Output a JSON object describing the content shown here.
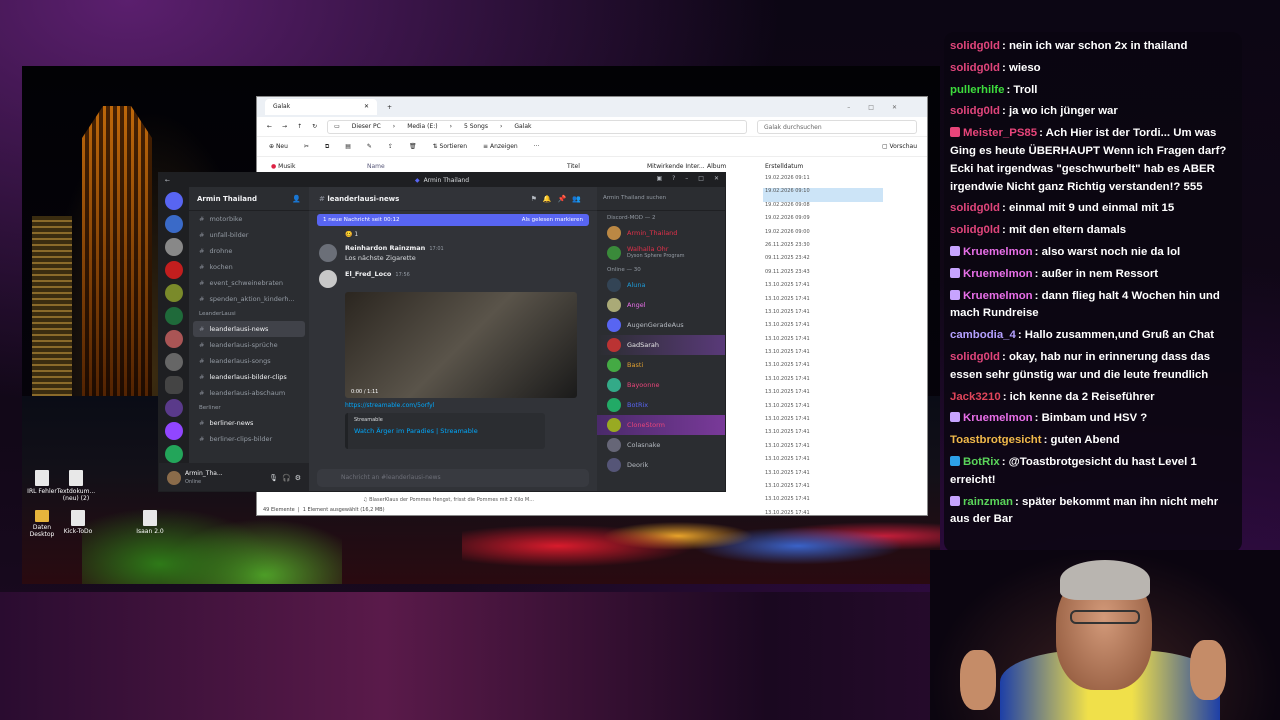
{
  "explorer": {
    "tab_title": "Galak",
    "crumbs": [
      "Dieser PC",
      "Media (E:)",
      "5 Songs",
      "Galak"
    ],
    "search_placeholder": "Galak durchsuchen",
    "cmd_new": "Neu",
    "cmd_sort": "Sortieren",
    "cmd_view": "Anzeigen",
    "cmd_preview": "Vorschau",
    "nav_item": "Musik",
    "col_name": "Name",
    "col_title": "Titel",
    "col_artist": "Mitwirkende Inter...",
    "col_album": "Album",
    "col_created": "Erstelldatum",
    "dates": [
      "19.02.2026 09:11",
      "19.02.2026 09:10",
      "19.02.2026 09:08",
      "19.02.2026 09:09",
      "19.02.2026 09:00",
      "26.11.2025 23:30",
      "09.11.2025 23:42",
      "09.11.2025 23:43",
      "13.10.2025 17:41",
      "13.10.2025 17:41",
      "13.10.2025 17:41",
      "13.10.2025 17:41",
      "13.10.2025 17:41",
      "13.10.2025 17:41",
      "13.10.2025 17:41",
      "13.10.2025 17:41",
      "13.10.2025 17:41",
      "13.10.2025 17:41",
      "13.10.2025 17:41",
      "13.10.2025 17:41",
      "13.10.2025 17:41",
      "13.10.2025 17:41",
      "13.10.2025 17:41",
      "13.10.2025 17:41",
      "13.10.2025 17:41",
      "13.10.2025 17:41",
      "13.10.2025 17:41"
    ],
    "status_count": "49 Elemente",
    "status_sel": "1 Element ausgewählt (16,2 MB)",
    "bottom_file": "BlaserKlaus der Pommes Hengst, frisst die Pommes mit 2 Kilo M..."
  },
  "desktop": {
    "icons": [
      "IRL Fehler",
      "Textdokum... (neu) (2)",
      "Daten Desktop",
      "Kick-ToDo",
      "Isaan 2.0"
    ]
  },
  "discord": {
    "window_title": "Armin Thailand",
    "server_name": "Armin Thailand",
    "channels_top": [
      "motorbike",
      "unfall-bilder",
      "drohne",
      "kochen",
      "event_schweinebraten",
      "spenden_aktion_kinderh..."
    ],
    "category_leander": "LeanderLausi",
    "active_channel": "leanderlausi-news",
    "channels_leander": [
      "leanderlausi-sprüche",
      "leanderlausi-songs",
      "leanderlausi-bilder-clips",
      "leanderlausi-abschaum"
    ],
    "category_berliner": "Berliner",
    "channels_berliner": [
      "berliner-news",
      "berliner-clips-bilder"
    ],
    "user_name": "Armin_Tha...",
    "user_status": "Online",
    "header_channel": "leanderlausi-news",
    "banner_text": "1 neue Nachricht seit 00:12",
    "banner_action": "Als gelesen markieren",
    "reaction_count": "1",
    "messages": [
      {
        "author": "Reinhardon Rainzman",
        "time": "17:01",
        "text": "Los nächste Zigarette"
      },
      {
        "author": "El_Fred_Loco",
        "time": "17:56",
        "text": ""
      }
    ],
    "video_time": "0:00 / 1:11",
    "link": "https://streamable.com/5orfyl",
    "embed_provider": "Streamable",
    "embed_title": "Watch Ärger im Paradies | Streamable",
    "input_placeholder": "Nachricht an #leanderlausi-news",
    "member_search": "Armin Thailand suchen",
    "member_cat1": "Discord-MOD — 2",
    "mods": [
      "Armin_Thailand",
      "Walhalla Ohr"
    ],
    "mod_sub": "Dyson Sphere Program",
    "member_cat2": "Online — 30",
    "members": [
      "Aluna",
      "Angel",
      "AugenGeradeAus",
      "GadSarah",
      "Basti",
      "Bayoonne",
      "BotRix",
      "CloneStorm",
      "Colasnake",
      "Deorik"
    ]
  },
  "chat": {
    "messages": [
      {
        "user": "solidg0ld",
        "color": "#e0457b",
        "text": ": nein ich war schon 2x in thailand",
        "badge": ""
      },
      {
        "user": "solidg0ld",
        "color": "#e0457b",
        "text": ": wieso",
        "badge": ""
      },
      {
        "user": "pullerhilfe",
        "color": "#3ddc3d",
        "text": ": Troll",
        "badge": ""
      },
      {
        "user": "solidg0ld",
        "color": "#e0457b",
        "text": ": ja wo ich jünger war",
        "badge": ""
      },
      {
        "user": "Meister_PS85",
        "color": "#e8457a",
        "text": ": Ach Hier ist der Tordi... Um was Ging es heute ÜBERHAUPT Wenn ich Fragen darf? Ecki hat irgendwas \"geschwurbelt\" hab es ABER irgendwie Nicht ganz Richtig verstanden!? 555",
        "badge": "#e8457a"
      },
      {
        "user": "solidg0ld",
        "color": "#e0457b",
        "text": ": einmal mit 9 und einmal mit 15",
        "badge": ""
      },
      {
        "user": "solidg0ld",
        "color": "#e0457b",
        "text": ": mit den eltern damals",
        "badge": ""
      },
      {
        "user": "Kruemelmon",
        "color": "#e86fe8",
        "text": ": also warst noch nie da lol",
        "badge": "#c7a4ff"
      },
      {
        "user": "Kruemelmon",
        "color": "#e86fe8",
        "text": ": außer in nem Ressort",
        "badge": "#c7a4ff"
      },
      {
        "user": "Kruemelmon",
        "color": "#e86fe8",
        "text": ": dann flieg halt 4 Wochen hin und mach Rundreise",
        "badge": "#c7a4ff"
      },
      {
        "user": "cambodia_4",
        "color": "#b4a0ff",
        "text": ": Hallo zusammen,und Gruß an Chat",
        "badge": ""
      },
      {
        "user": "solidg0ld",
        "color": "#e0457b",
        "text": ": okay, hab nur in erinnerung dass das essen sehr günstig war und die leute freundlich",
        "badge": ""
      },
      {
        "user": "Jack3210",
        "color": "#e0455a",
        "text": ": ich kenne da 2 Reiseführer",
        "badge": ""
      },
      {
        "user": "Kruemelmon",
        "color": "#e86fe8",
        "text": ": Bimbam und HSV ?",
        "badge": "#c7a4ff"
      },
      {
        "user": "Toastbrotgesicht",
        "color": "#f0b94a",
        "text": ": guten Abend",
        "badge": ""
      },
      {
        "user": "BotRix",
        "color": "#5ad45a",
        "text": ": @Toastbrotgesicht du hast Level 1 erreicht!",
        "badge": "#2da0e8"
      },
      {
        "user": "rainzman",
        "color": "#5ad45a",
        "text": ": später bekommt man ihn nicht mehr aus der Bar",
        "badge": "#c7a4ff"
      }
    ]
  },
  "colors": {
    "discord_blurple": "#5865f2",
    "chat_bg": "#0a0610"
  }
}
